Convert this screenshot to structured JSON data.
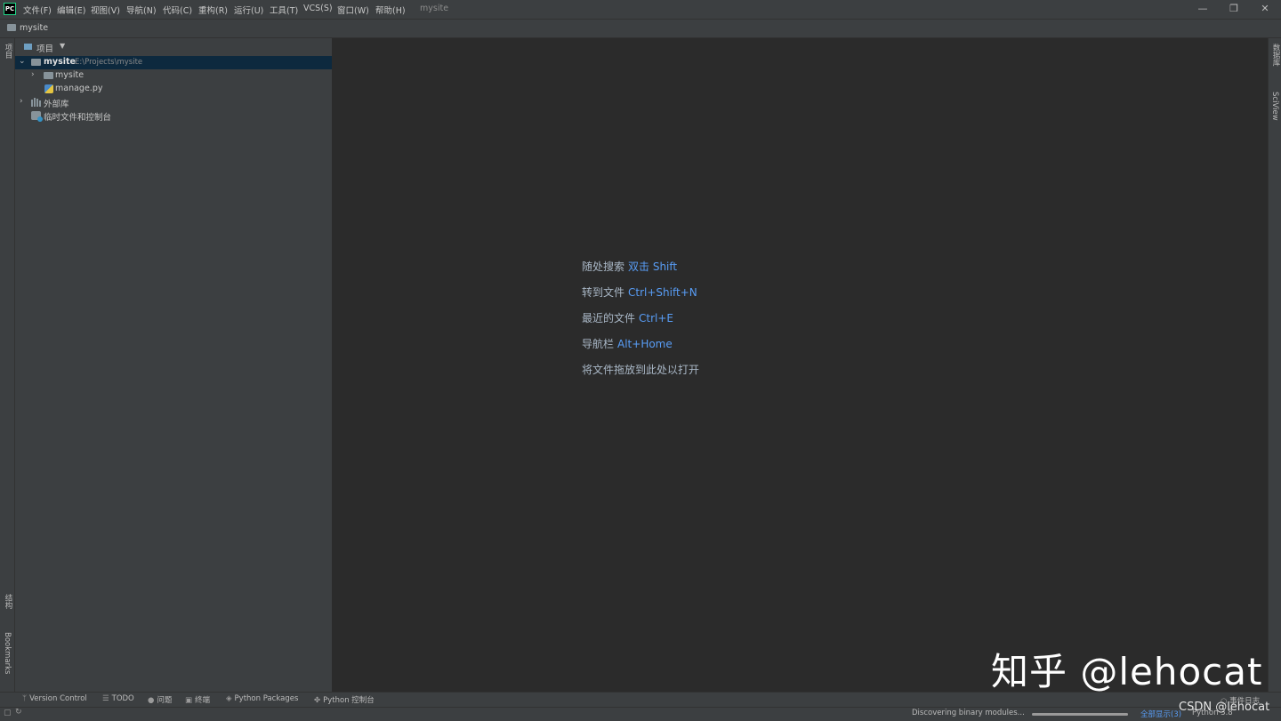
{
  "app": {
    "logo_text": "PC",
    "window_title": "mysite"
  },
  "menu": [
    "文件(F)",
    "编辑(E)",
    "视图(V)",
    "导航(N)",
    "代码(C)",
    "重构(R)",
    "运行(U)",
    "工具(T)",
    "VCS(S)",
    "窗口(W)",
    "帮助(H)"
  ],
  "window_controls": {
    "minimize": "—",
    "restore": "❐",
    "close": "✕"
  },
  "navbar": {
    "label": "mysite"
  },
  "left_strip": {
    "project": "项目",
    "structure": "结构",
    "bookmarks": "Bookmarks"
  },
  "right_strip": {
    "database": "数据库",
    "sciview": "SciView"
  },
  "project_panel": {
    "header": "项目",
    "tree": {
      "root_name": "mysite",
      "root_path": "E:\\Projects\\mysite",
      "child_folder": "mysite",
      "child_file": "manage.py",
      "external_libs": "外部库",
      "scratches": "临时文件和控制台"
    }
  },
  "editor_hints": [
    {
      "label": "随处搜索",
      "key": "双击 Shift"
    },
    {
      "label": "转到文件",
      "key": "Ctrl+Shift+N"
    },
    {
      "label": "最近的文件",
      "key": "Ctrl+E"
    },
    {
      "label": "导航栏",
      "key": "Alt+Home"
    },
    {
      "label": "将文件拖放到此处以打开",
      "key": ""
    }
  ],
  "bottom_tabs": [
    {
      "icon": "branch-icon",
      "label": "Version Control"
    },
    {
      "icon": "list-icon",
      "label": "TODO"
    },
    {
      "icon": "info-icon",
      "label": "问题"
    },
    {
      "icon": "terminal-icon",
      "label": "终端"
    },
    {
      "icon": "layers-icon",
      "label": "Python Packages"
    },
    {
      "icon": "python-icon",
      "label": "Python 控制台"
    }
  ],
  "status": {
    "task": "Discovering binary modules...",
    "progress": 1.0,
    "show_all": "全部显示(3)",
    "interpreter": "Python 3.8",
    "event_log": "事件日志"
  },
  "watermarks": {
    "zhihu": "知乎 @lehocat",
    "csdn": "CSDN @lehocat"
  },
  "colors": {
    "background": "#2b2b2b",
    "panel": "#3c3f41",
    "selection": "#0d293e",
    "accent": "#589df6"
  }
}
